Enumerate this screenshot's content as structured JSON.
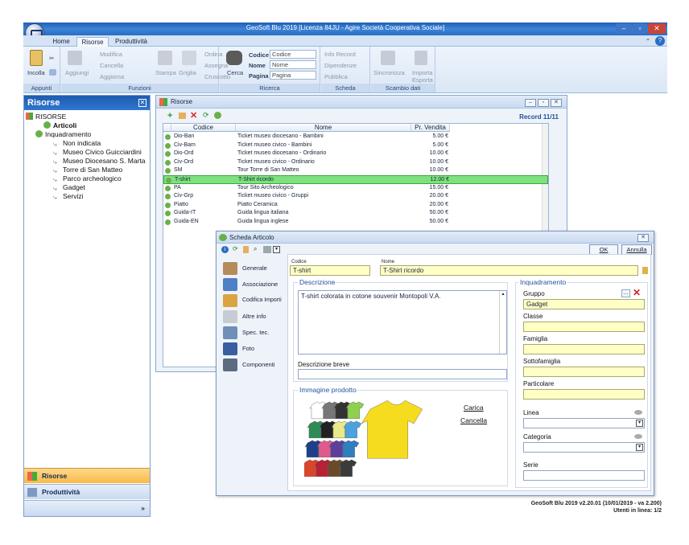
{
  "window": {
    "title": "GeoSoft Blu 2019 [Licenza 84JU - Agire Società Cooperativa Sociale]"
  },
  "tabs": [
    {
      "label": "Home"
    },
    {
      "label": "Risorse"
    },
    {
      "label": "Produttività"
    }
  ],
  "ribbon": {
    "appunti": {
      "label": "Appunti",
      "incolla": "Incolla"
    },
    "funzioni": {
      "label": "Funzioni",
      "aggiungi": "Aggiungi",
      "modifica": "Modifica",
      "cancella": "Cancella",
      "aggiorna": "Aggiorna",
      "stampa": "Stampa",
      "griglia": "Griglia",
      "ordina": "Ordina",
      "assegna": "Assegna",
      "cruscotto": "Cruscotto"
    },
    "ricerca": {
      "label": "Ricerca",
      "cerca": "Cerca",
      "codice_label": "Codice",
      "codice_value": "Codice",
      "nome_label": "Nome",
      "nome_value": "Nome",
      "pagina_label": "Pagina",
      "pagina_value": "Pagina"
    },
    "scheda": {
      "label": "Scheda",
      "info_record": "Info Record",
      "dipendenze": "Dipendenze",
      "pubblica": "Pubblica"
    },
    "scambio": {
      "label": "Scambio dati",
      "sincronizza": "Sincronizza",
      "importa": "Importa",
      "esporta": "Esporta"
    }
  },
  "leftpanel": {
    "title": "Risorse",
    "tree": [
      {
        "label": "RISORSE"
      },
      {
        "label": "Articoli"
      },
      {
        "label": "Inquadramento"
      },
      {
        "label": "Non indicata"
      },
      {
        "label": "Museo Civico Guicciardini"
      },
      {
        "label": "Museo Diocesano S. Marta"
      },
      {
        "label": "Torre di San Matteo"
      },
      {
        "label": "Parco archeologico"
      },
      {
        "label": "Gadget"
      },
      {
        "label": "Servizi"
      }
    ],
    "nav": [
      {
        "label": "Risorse"
      },
      {
        "label": "Produttività"
      }
    ]
  },
  "resources": {
    "title": "Risorse",
    "record": "Record 11/11",
    "columns": [
      "Codice",
      "Nome",
      "Pr. Vendita"
    ],
    "rows": [
      {
        "codice": "Dio-Ban",
        "nome": "Ticket museo diocesano - Bambini",
        "prezzo": "5.00 €"
      },
      {
        "codice": "Civ-Bam",
        "nome": "Ticket museo civico - Bambini",
        "prezzo": "5.00 €"
      },
      {
        "codice": "Dio-Ord",
        "nome": "Ticket museo diocesano - Ordinario",
        "prezzo": "10.00 €"
      },
      {
        "codice": "Civ-Ord",
        "nome": "Ticket museo civico - Ordinario",
        "prezzo": "10.00 €"
      },
      {
        "codice": "SM",
        "nome": "Tour Torre di San Matteo",
        "prezzo": "10.00 €"
      },
      {
        "codice": "T-shirt",
        "nome": "T-Shirt ricordo",
        "prezzo": "12.00 €"
      },
      {
        "codice": "PA",
        "nome": "Tour Sito Archeologico",
        "prezzo": "15.00 €"
      },
      {
        "codice": "Civ-Grp",
        "nome": "Ticket museo civico - Gruppi",
        "prezzo": "20.00 €"
      },
      {
        "codice": "Piatto",
        "nome": "Piatto Ceramica",
        "prezzo": "20.00 €"
      },
      {
        "codice": "Guida-IT",
        "nome": "Guida lingua italiana",
        "prezzo": "50.00 €"
      },
      {
        "codice": "Guida-EN",
        "nome": "Guida lingua inglese",
        "prezzo": "50.00 €"
      }
    ]
  },
  "scheda": {
    "title": "Scheda Articolo",
    "ok": "OK",
    "annulla": "Annulla",
    "sections": [
      {
        "label": "Generale"
      },
      {
        "label": "Associazione"
      },
      {
        "label": "Codifica Importi"
      },
      {
        "label": "Altre info"
      },
      {
        "label": "Spec. tec."
      },
      {
        "label": "Foto"
      },
      {
        "label": "Componenti"
      }
    ],
    "codice_label": "Codice",
    "codice_value": "T-shirt",
    "nome_label": "Nome",
    "nome_value": "T-Shirt ricordo",
    "descrizione_title": "Descrizione",
    "descrizione_value": "T-shirt colorata in cotone souvenir Montopoli V.A.",
    "descrizione_breve_label": "Descrizione breve",
    "immagine_title": "Immagine prodotto",
    "carica": "Carica",
    "cancella": "Cancella",
    "inquadramento_title": "Inquadramento",
    "gruppo_label": "Gruppo",
    "gruppo_value": "Gadget",
    "classe_label": "Classe",
    "famiglia_label": "Famiglia",
    "sottofamiglia_label": "Sottofamiglia",
    "particolare_label": "Particolare",
    "linea_label": "Linea",
    "categoria_label": "Categoria",
    "serie_label": "Serie"
  },
  "footer": {
    "version": "GeoSoft Blu 2019  v2.20.01 (10/01/2019 - va 2.200)",
    "users": "Utenti in linea: 1/2"
  },
  "colors": {
    "accent": "#2a6ec4",
    "selected_row": "#7ee07e",
    "required_field": "#ffffc5"
  }
}
